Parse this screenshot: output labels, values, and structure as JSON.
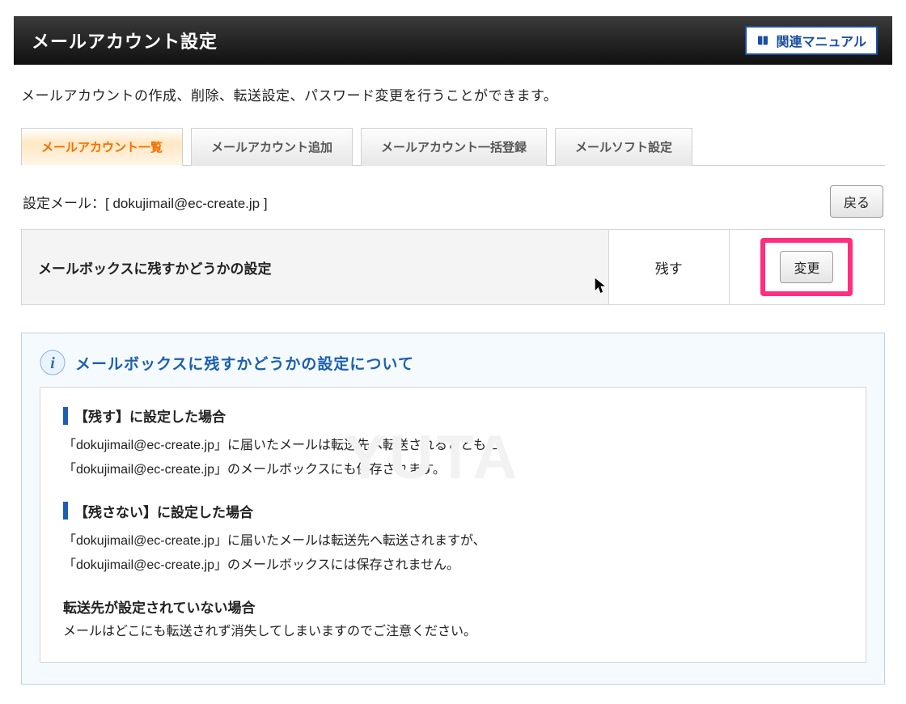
{
  "header": {
    "title": "メールアカウント設定",
    "related_manual": "関連マニュアル"
  },
  "description": "メールアカウントの作成、削除、転送設定、パスワード変更を行うことができます。",
  "tabs": [
    {
      "label": "メールアカウント一覧",
      "active": true
    },
    {
      "label": "メールアカウント追加",
      "active": false
    },
    {
      "label": "メールアカウント一括登録",
      "active": false
    },
    {
      "label": "メールソフト設定",
      "active": false
    }
  ],
  "setting": {
    "label_prefix": "設定メール：[ ",
    "email": "dokujimail@ec-create.jp",
    "label_suffix": " ]",
    "back_button": "戻る"
  },
  "table": {
    "row_label": "メールボックスに残すかどうかの設定",
    "row_value": "残す",
    "change_button": "変更"
  },
  "info": {
    "title": "メールボックスに残すかどうかの設定について",
    "case1_heading": "【残す】に設定した場合",
    "case1_line1": "「dokujimail@ec-create.jp」に届いたメールは転送先へ転送されるとともに、",
    "case1_line2": "「dokujimail@ec-create.jp」のメールボックスにも保存されます。",
    "case2_heading": "【残さない】に設定した場合",
    "case2_line1": "「dokujimail@ec-create.jp」に届いたメールは転送先へ転送されますが、",
    "case2_line2": "「dokujimail@ec-create.jp」のメールボックスには保存されません。",
    "case3_heading": "転送先が設定されていない場合",
    "case3_text": "メールはどこにも転送されず消失してしまいますのでご注意ください。"
  },
  "watermark": "YUTA"
}
